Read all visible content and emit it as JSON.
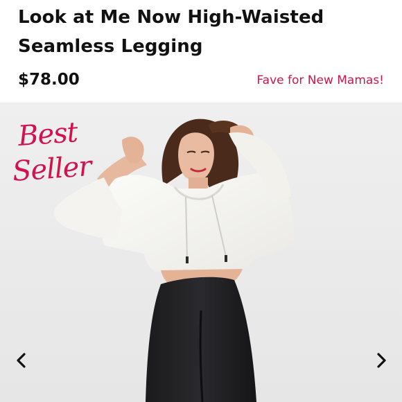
{
  "product": {
    "title": "Look at Me Now High-Waisted Seamless Legging",
    "price": "$78.00",
    "promo_tag": "Fave for New Mamas!"
  },
  "gallery": {
    "badge_line_1": "Best",
    "badge_line_2": "Seller",
    "photo_icon": "model-photo",
    "prev_icon": "chevron-left-icon",
    "next_icon": "chevron-right-icon"
  },
  "colors": {
    "accent": "#c8174a",
    "badge": "#d1124f",
    "photo_background": "#eeeeee",
    "text": "#111111"
  }
}
